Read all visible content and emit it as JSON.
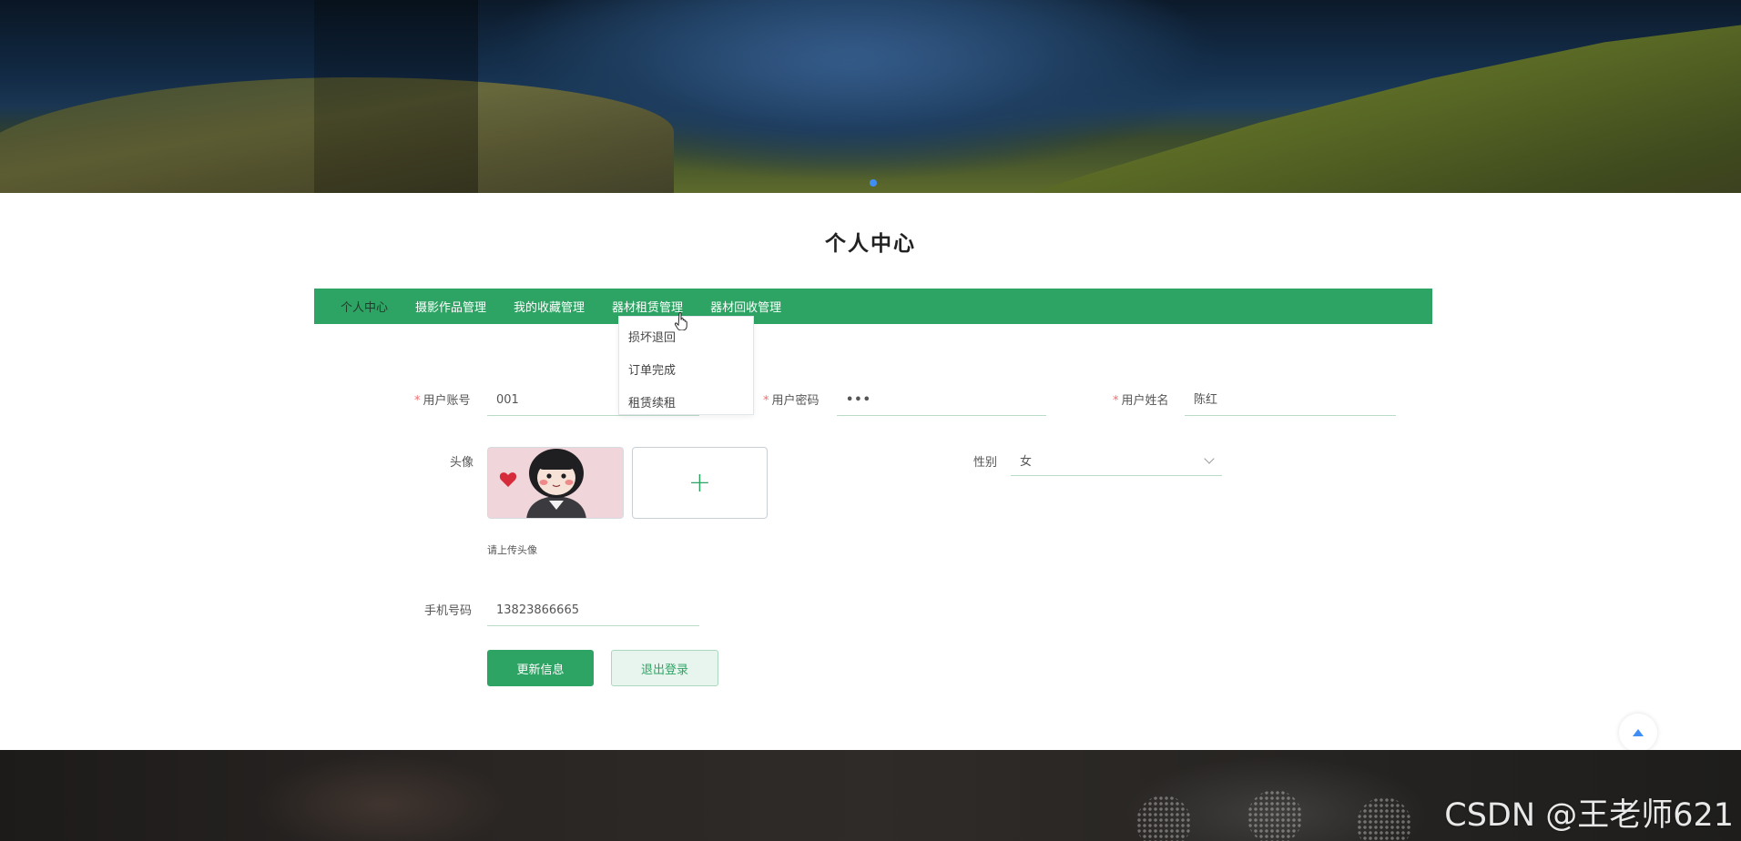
{
  "page": {
    "title": "个人中心"
  },
  "nav": {
    "items": [
      {
        "label": "个人中心",
        "active": true
      },
      {
        "label": "摄影作品管理"
      },
      {
        "label": "我的收藏管理"
      },
      {
        "label": "器材租赁管理"
      },
      {
        "label": "器材回收管理"
      }
    ]
  },
  "dropdown": {
    "parent": "器材租赁管理",
    "items": [
      "损坏退回",
      "订单完成",
      "租赁续租"
    ]
  },
  "form": {
    "account": {
      "label": "用户账号",
      "required": "*",
      "value": "001"
    },
    "password": {
      "label": "用户密码",
      "required": "*",
      "value": "•••"
    },
    "name": {
      "label": "用户姓名",
      "required": "*",
      "value": "陈红"
    },
    "avatar": {
      "label": "头像",
      "hint": "请上传头像",
      "upload_glyph": "+"
    },
    "gender": {
      "label": "性别",
      "value": "女"
    },
    "phone": {
      "label": "手机号码",
      "value": "13823866665"
    }
  },
  "buttons": {
    "update": "更新信息",
    "logout": "退出登录"
  },
  "watermark": "CSDN @王老师621",
  "colors": {
    "primary": "#2ea464",
    "required": "#f56c6c",
    "accent": "#3f8ef5"
  },
  "icons": [
    "plus-icon",
    "chevron-down-icon",
    "caret-up-icon",
    "pointer-hand-icon"
  ]
}
